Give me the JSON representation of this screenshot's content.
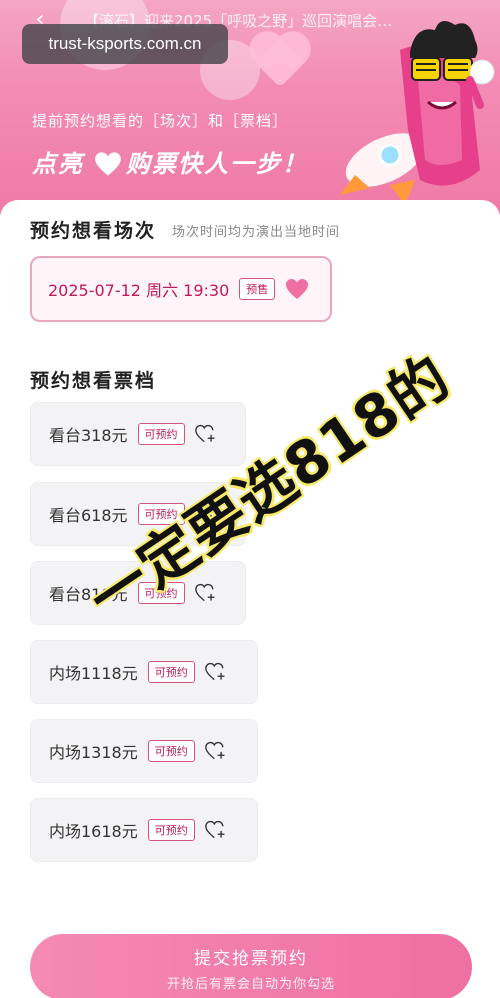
{
  "header": {
    "back_icon": "chevron-left-icon",
    "title": "【滚石】迎来2025「呼吸之野」巡回演唱会…",
    "url": "trust-ksports.com.cn",
    "promo_line1": "提前预约想看的［场次］和［票档］",
    "promo_line2_left": "点亮",
    "promo_line2_right": "购票快人一步！"
  },
  "sessions_section": {
    "title": "预约想看场次",
    "hint": "场次时间均为演出当地时间",
    "sessions": [
      {
        "datetime": "2025-07-12 周六 19:30",
        "tag": "预售",
        "selected": true
      }
    ]
  },
  "tickets_section": {
    "title": "预约想看票档",
    "tickets": [
      {
        "label": "看台318元",
        "tag": "可预约"
      },
      {
        "label": "看台618元",
        "tag": "可预约"
      },
      {
        "label": "看台818元",
        "tag": "可预约"
      },
      {
        "label": "内场1118元",
        "tag": "可预约"
      },
      {
        "label": "内场1318元",
        "tag": "可预约"
      },
      {
        "label": "内场1618元",
        "tag": "可预约"
      }
    ]
  },
  "overlay": {
    "text": "一定要选818的"
  },
  "bottom": {
    "submit_label": "提交抢票预约",
    "submit_sub": "开抢后有票会自动为你勾选"
  },
  "colors": {
    "accent": "#ef6fa2",
    "tag_red": "#c2185b",
    "header_pink": "#f38cb4"
  }
}
